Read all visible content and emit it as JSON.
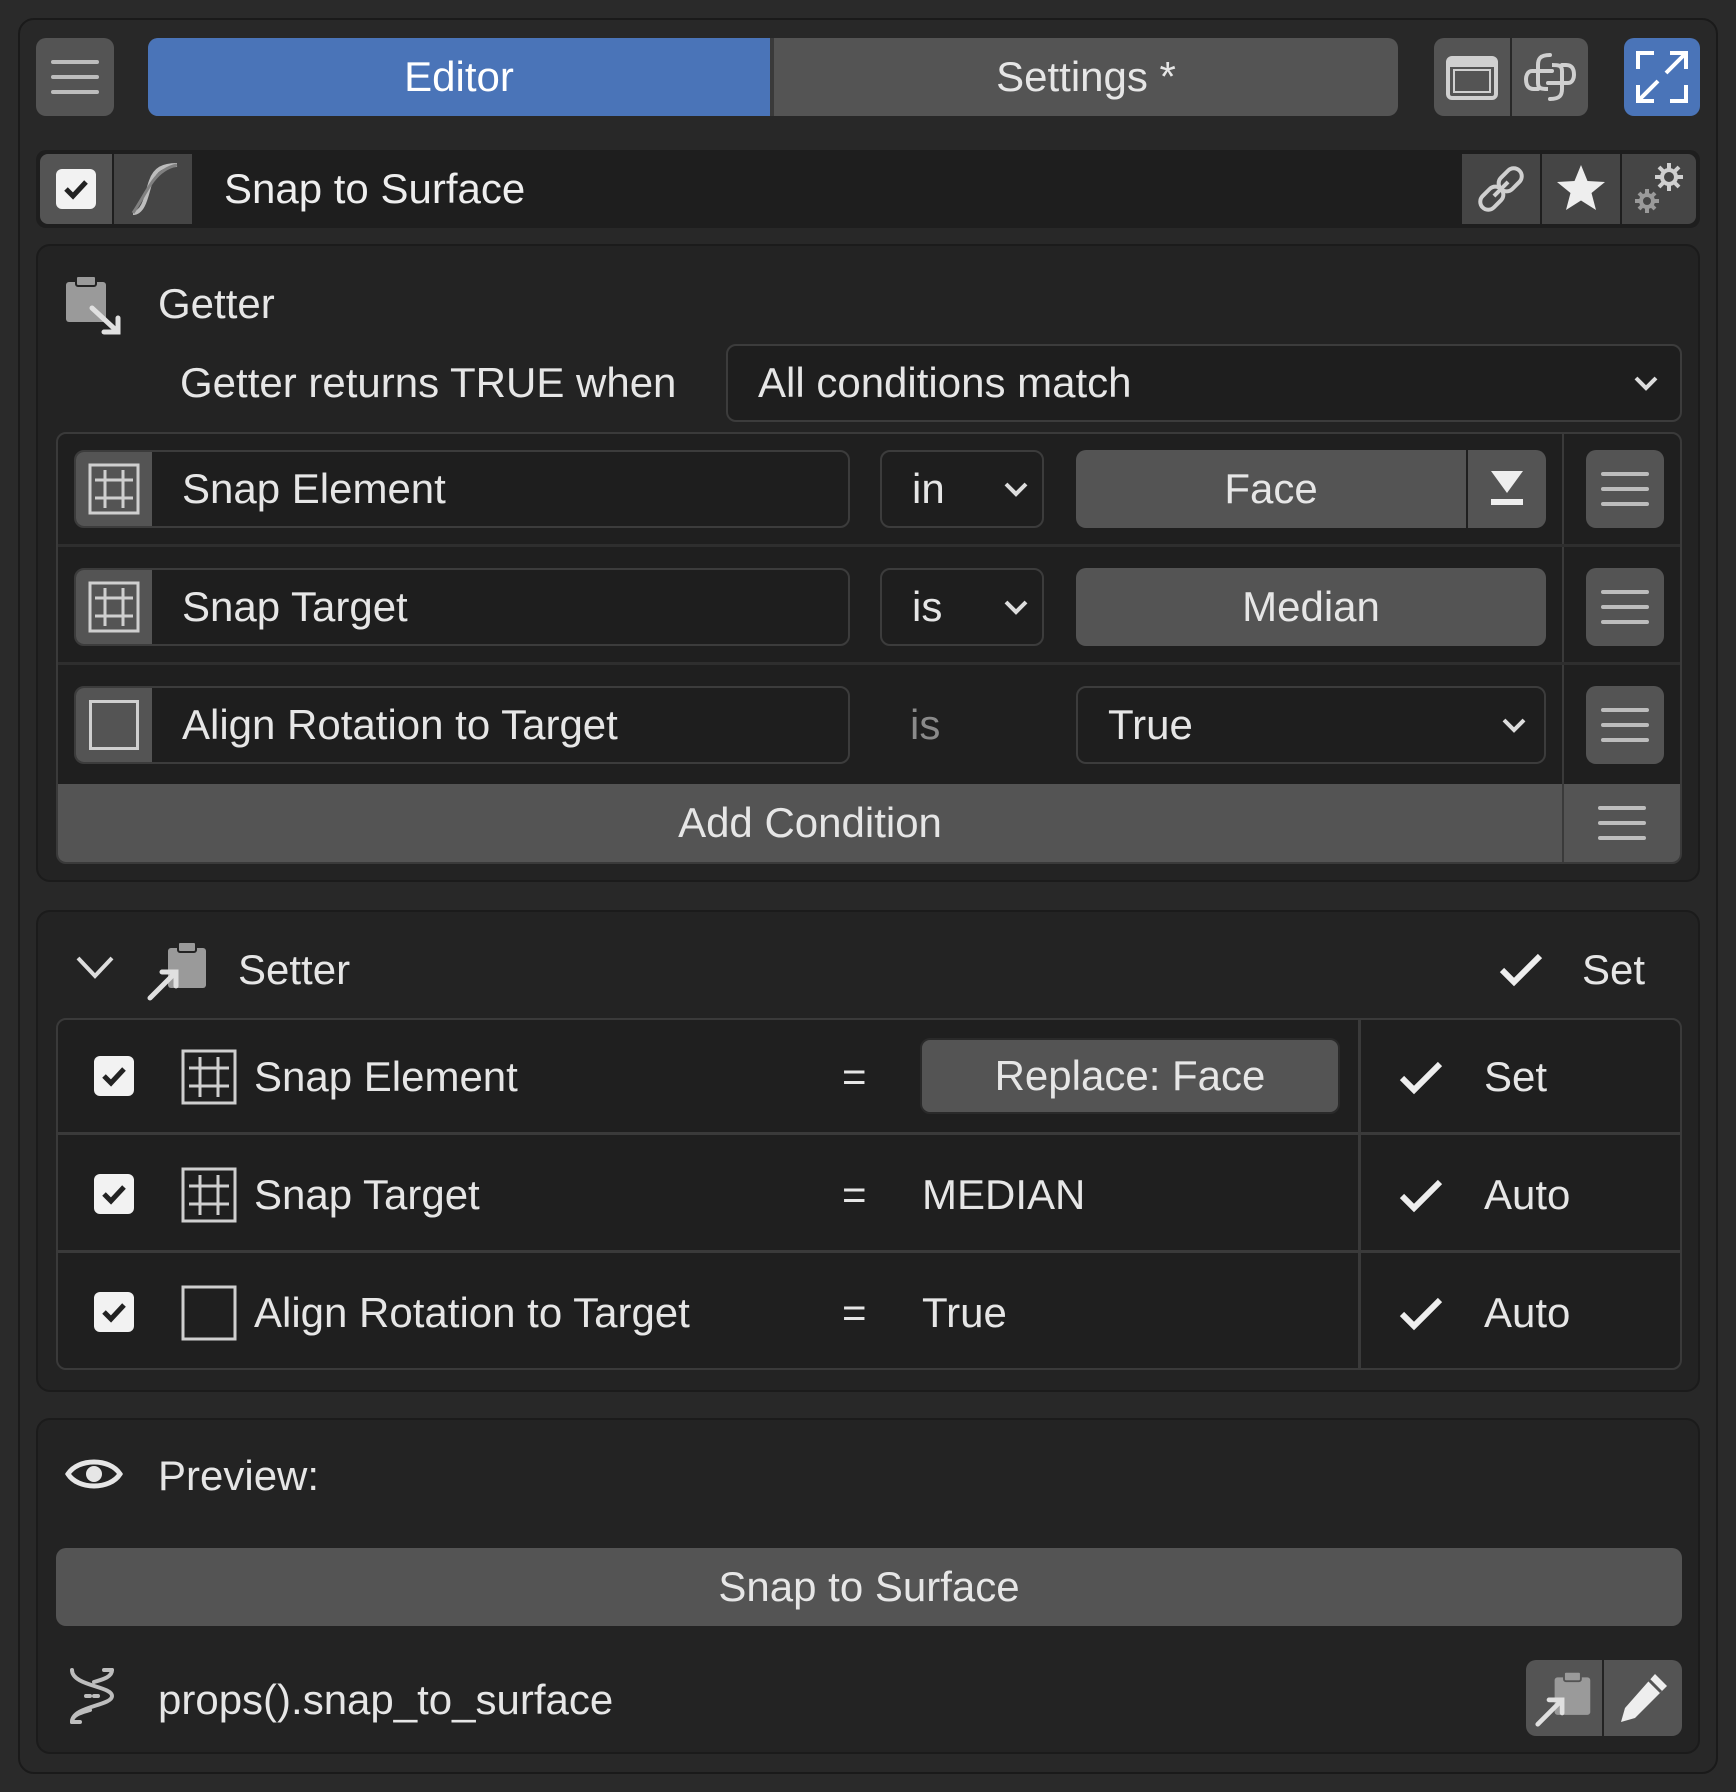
{
  "tabs": [
    {
      "label": "Editor",
      "active": true
    },
    {
      "label": "Settings *",
      "active": false
    }
  ],
  "colors": {
    "accent": "#4a74b8",
    "button": "#545454",
    "field": "#1e1e1e"
  },
  "header": {
    "title": "Snap to Surface",
    "enabled": true
  },
  "getter": {
    "title": "Getter",
    "returns_label": "Getter returns TRUE when",
    "mode": "All conditions match",
    "conditions": [
      {
        "property": "Snap Element",
        "operator": "in",
        "value": "Face"
      },
      {
        "property": "Snap Target",
        "operator": "is",
        "value": "Median"
      },
      {
        "property": "Align Rotation to Target",
        "operator": "is",
        "value": "True"
      }
    ],
    "add_label": "Add Condition"
  },
  "setter": {
    "title": "Setter",
    "set_label": "Set",
    "rows": [
      {
        "property": "Snap Element",
        "equals": "=",
        "value": "Replace: Face",
        "mode": "Set"
      },
      {
        "property": "Snap Target",
        "equals": "=",
        "value": "MEDIAN",
        "mode": "Auto"
      },
      {
        "property": "Align Rotation to Target",
        "equals": "=",
        "value": "True",
        "mode": "Auto"
      }
    ]
  },
  "preview": {
    "label": "Preview:",
    "button": "Snap to Surface",
    "path": "props().snap_to_surface"
  }
}
